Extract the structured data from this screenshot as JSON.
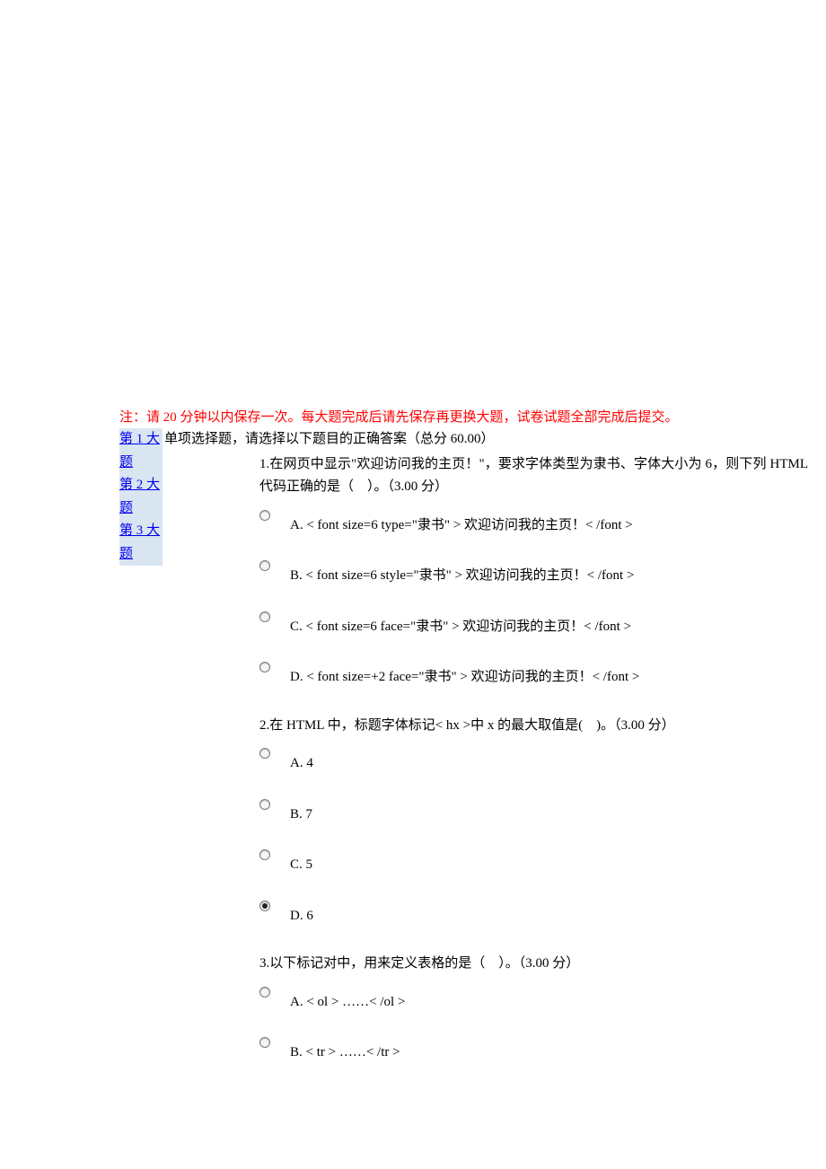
{
  "notice": "注：请 20 分钟以内保存一次。每大题完成后请先保存再更换大题，试卷试题全部完成后提交。",
  "nav": [
    {
      "label": "第 1 大题"
    },
    {
      "label": "第 2 大题"
    },
    {
      "label": "第 3 大题"
    }
  ],
  "section_header": "单项选择题，请选择以下题目的正确答案（总分 60.00）",
  "questions": [
    {
      "stem": "1.在网页中显示\"欢迎访问我的主页！\"，要求字体类型为隶书、字体大小为 6，则下列 HTML 代码正确的是（　）。（3.00 分）",
      "options": [
        {
          "text": "A. < font size=6 type=\"隶书\" > 欢迎访问我的主页！< /font >",
          "selected": false
        },
        {
          "text": "B. < font size=6 style=\"隶书\" > 欢迎访问我的主页！< /font >",
          "selected": false
        },
        {
          "text": "C. < font size=6 face=\"隶书\" > 欢迎访问我的主页！< /font >",
          "selected": false
        },
        {
          "text": "D. < font size=+2 face=\"隶书\" > 欢迎访问我的主页！< /font >",
          "selected": false
        }
      ]
    },
    {
      "stem": "2.在 HTML 中，标题字体标记< hx >中 x 的最大取值是(　)。（3.00 分）",
      "options": [
        {
          "text": "A. 4",
          "selected": false
        },
        {
          "text": "B. 7",
          "selected": false
        },
        {
          "text": "C. 5",
          "selected": false
        },
        {
          "text": "D. 6",
          "selected": true
        }
      ]
    },
    {
      "stem": "3.以下标记对中，用来定义表格的是（　）。（3.00 分）",
      "options": [
        {
          "text": "A. < ol > ……< /ol >",
          "selected": false
        },
        {
          "text": "B. < tr > ……< /tr >",
          "selected": false
        }
      ]
    }
  ]
}
